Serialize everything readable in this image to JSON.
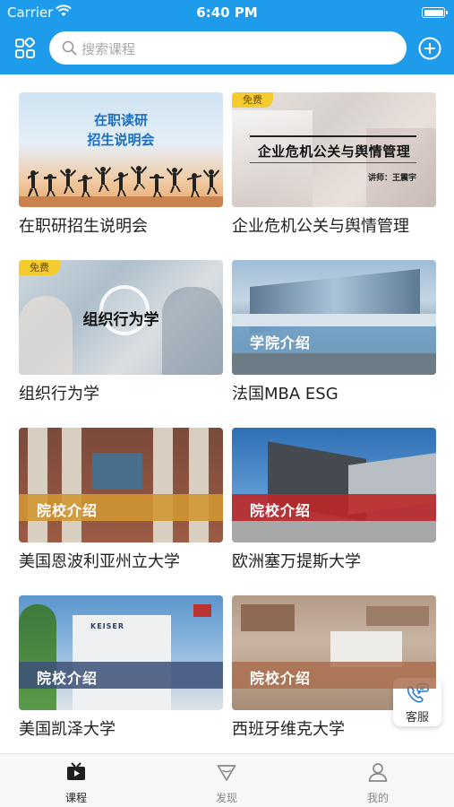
{
  "status_bar": {
    "carrier": "Carrier",
    "time": "6:40 PM"
  },
  "header": {
    "search_placeholder": "搜索课程",
    "accent_color": "#1e9bea"
  },
  "courses": [
    {
      "title": "在职研招生说明会",
      "thumb_text_line1": "在职读研",
      "thumb_text_line2": "招生说明会"
    },
    {
      "title": "企业危机公关与舆情管理",
      "badge": "免费",
      "thumb_text": "企业危机公关与舆情管理",
      "thumb_subtext": "讲师：王震宇"
    },
    {
      "title": "组织行为学",
      "badge": "免费",
      "thumb_text": "组织行为学"
    },
    {
      "title": "法国MBA ESG",
      "band_text": "学院介绍"
    },
    {
      "title": "美国恩波利亚州立大学",
      "band_text": "院校介绍"
    },
    {
      "title": "欧洲塞万提斯大学",
      "band_text": "院校介绍"
    },
    {
      "title": "美国凯泽大学",
      "band_text": "院校介绍"
    },
    {
      "title": "西班牙维克大学",
      "band_text": "院校介绍"
    }
  ],
  "service": {
    "label": "客服"
  },
  "tabs": [
    {
      "label": "课程",
      "icon": "tv-icon",
      "active": true
    },
    {
      "label": "发现",
      "icon": "compass-icon",
      "active": false
    },
    {
      "label": "我的",
      "icon": "user-icon",
      "active": false
    }
  ]
}
